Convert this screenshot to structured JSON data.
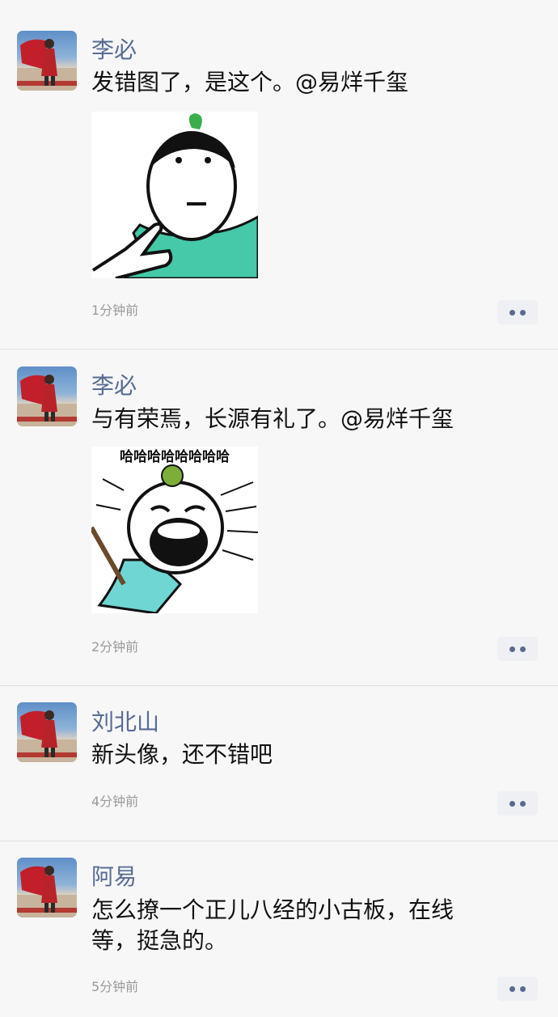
{
  "comments": [
    {
      "name": "李必",
      "text": "发错图了，是这个。@易烊千玺",
      "time": "1分钟前",
      "image": "meme-pointing"
    },
    {
      "name": "李必",
      "text": "与有荣焉，长源有礼了。@易烊千玺",
      "time": "2分钟前",
      "image": "meme-laughing",
      "image_caption": "哈哈哈哈哈哈哈哈"
    },
    {
      "name": "刘北山",
      "text": "新头像，还不错吧",
      "time": "4分钟前"
    },
    {
      "name": "阿易",
      "text": "怎么撩一个正儿八经的小古板，在线等，挺急的。",
      "time": "5分钟前"
    }
  ],
  "colors": {
    "name": "#586b95",
    "background": "#f7f7f7",
    "meme_robe": "#45c9a8"
  },
  "icons": {
    "more": "more-dots-icon"
  }
}
